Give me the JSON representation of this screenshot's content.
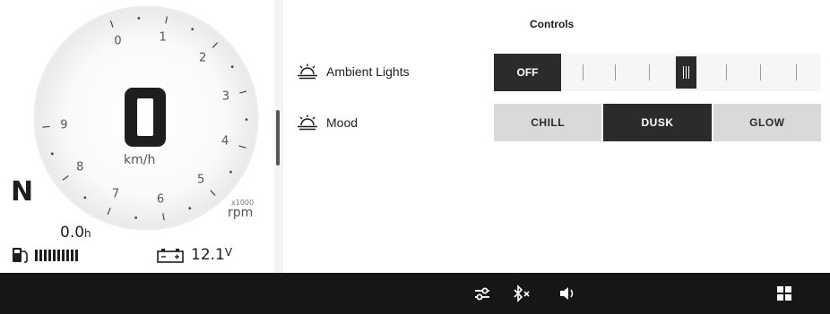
{
  "cluster": {
    "gear": "N",
    "speed": "0",
    "speed_unit": "km/h",
    "rpm_ticks": [
      "0",
      "1",
      "2",
      "3",
      "4",
      "5",
      "6",
      "7",
      "8",
      "9"
    ],
    "rpm_multiplier": "x1000",
    "rpm_unit": "rpm",
    "trip_value": "0.0",
    "trip_unit": "h",
    "fuel_level_bars": 10,
    "voltage_value": "12.1",
    "voltage_unit": "V"
  },
  "controls": {
    "title": "Controls",
    "ambient_lights": {
      "label": "Ambient Lights",
      "off_label": "OFF",
      "level": 4,
      "max_level": 7
    },
    "mood": {
      "label": "Mood",
      "options": [
        "CHILL",
        "DUSK",
        "GLOW"
      ],
      "selected": "DUSK"
    }
  },
  "colors": {
    "dark": "#2b2b2b",
    "bar_background": "#161616",
    "inactive_button": "#d9d9d9"
  },
  "bottom_bar": {
    "icons": [
      "settings-sliders-icon",
      "bluetooth-off-icon",
      "volume-icon",
      "apps-grid-icon"
    ]
  }
}
